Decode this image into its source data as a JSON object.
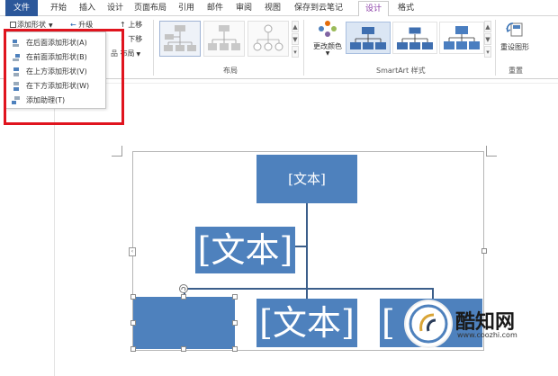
{
  "tabs": [
    {
      "label": "文件"
    },
    {
      "label": "开始"
    },
    {
      "label": "插入"
    },
    {
      "label": "设计"
    },
    {
      "label": "页面布局"
    },
    {
      "label": "引用"
    },
    {
      "label": "邮件"
    },
    {
      "label": "审阅"
    },
    {
      "label": "视图"
    },
    {
      "label": "保存到云笔记"
    },
    {
      "label": "设计"
    },
    {
      "label": "格式"
    }
  ],
  "ribbon": {
    "create_graphic": {
      "add_shape": "添加形状",
      "promote": "升级",
      "move_up": "上移",
      "move_down": "下移",
      "layout": "布局"
    },
    "layouts_group": "布局",
    "change_colors": "更改颜色",
    "smartart_styles_group": "SmartArt 样式",
    "reset_graphic": "重设图形",
    "reset_group": "重置"
  },
  "dropdown": {
    "items": [
      {
        "label": "在后面添加形状(A)"
      },
      {
        "label": "在前面添加形状(B)"
      },
      {
        "label": "在上方添加形状(V)"
      },
      {
        "label": "在下方添加形状(W)"
      },
      {
        "label": "添加助理(T)"
      }
    ]
  },
  "diagram": {
    "top_node": "[文本]",
    "assistant_node": "[文本]",
    "child_middle": "[文本]",
    "child_right": "["
  },
  "watermark": {
    "name": "酷知网",
    "url": "www.coozhi.com"
  },
  "colors": {
    "file_tab": "#2b579a",
    "active_tab": "#8a3ca6",
    "node_fill": "#4e81bd",
    "highlight": "#e0141e"
  }
}
